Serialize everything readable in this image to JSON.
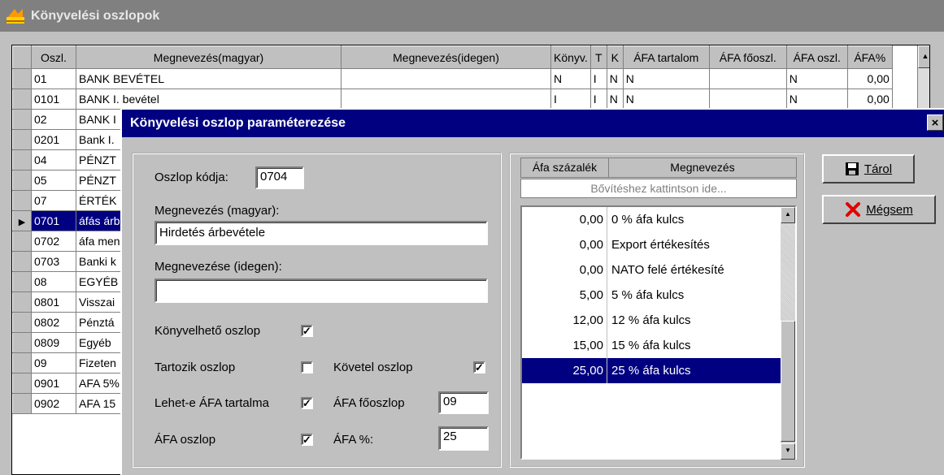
{
  "outer": {
    "title": "Könyvelési oszlopok",
    "columns": [
      "Oszl.",
      "Megnevezés(magyar)",
      "Megnevezés(idegen)",
      "Könyv.",
      "T",
      "K",
      "ÁFA tartalom",
      "ÁFA főoszl.",
      "ÁFA oszl.",
      "ÁFA%"
    ],
    "rows": [
      {
        "code": "01",
        "name": "BANK BEVÉTEL",
        "idegen": "",
        "konyv": "N",
        "t": "I",
        "k": "N",
        "afa_tart": "N",
        "afa_fo": "",
        "afa_oszl": "N",
        "afa_pct": "0,00",
        "selected": false
      },
      {
        "code": "0101",
        "name": "BANK I. bevétel",
        "idegen": "",
        "konyv": "I",
        "t": "I",
        "k": "N",
        "afa_tart": "N",
        "afa_fo": "",
        "afa_oszl": "N",
        "afa_pct": "0,00",
        "selected": false
      },
      {
        "code": "02",
        "name": "BANK I",
        "idegen": "",
        "konyv": "",
        "t": "",
        "k": "",
        "afa_tart": "",
        "afa_fo": "",
        "afa_oszl": "",
        "afa_pct": "",
        "selected": false
      },
      {
        "code": "0201",
        "name": "Bank I.",
        "idegen": "",
        "konyv": "",
        "t": "",
        "k": "",
        "afa_tart": "",
        "afa_fo": "",
        "afa_oszl": "",
        "afa_pct": "",
        "selected": false
      },
      {
        "code": "04",
        "name": "PÉNZT",
        "idegen": "",
        "konyv": "",
        "t": "",
        "k": "",
        "afa_tart": "",
        "afa_fo": "",
        "afa_oszl": "",
        "afa_pct": "",
        "selected": false
      },
      {
        "code": "05",
        "name": "PÉNZT",
        "idegen": "",
        "konyv": "",
        "t": "",
        "k": "",
        "afa_tart": "",
        "afa_fo": "",
        "afa_oszl": "",
        "afa_pct": "",
        "selected": false
      },
      {
        "code": "07",
        "name": "ÉRTÉK",
        "idegen": "",
        "konyv": "",
        "t": "",
        "k": "",
        "afa_tart": "",
        "afa_fo": "",
        "afa_oszl": "",
        "afa_pct": "",
        "selected": false
      },
      {
        "code": "0701",
        "name": "áfás árb",
        "idegen": "",
        "konyv": "",
        "t": "",
        "k": "",
        "afa_tart": "",
        "afa_fo": "",
        "afa_oszl": "",
        "afa_pct": "",
        "selected": true
      },
      {
        "code": "0702",
        "name": "áfa men",
        "idegen": "",
        "konyv": "",
        "t": "",
        "k": "",
        "afa_tart": "",
        "afa_fo": "",
        "afa_oszl": "",
        "afa_pct": "",
        "selected": false
      },
      {
        "code": "0703",
        "name": "Banki k",
        "idegen": "",
        "konyv": "",
        "t": "",
        "k": "",
        "afa_tart": "",
        "afa_fo": "",
        "afa_oszl": "",
        "afa_pct": "",
        "selected": false
      },
      {
        "code": "08",
        "name": "EGYÉB",
        "idegen": "",
        "konyv": "",
        "t": "",
        "k": "",
        "afa_tart": "",
        "afa_fo": "",
        "afa_oszl": "",
        "afa_pct": "",
        "selected": false
      },
      {
        "code": "0801",
        "name": "Visszai",
        "idegen": "",
        "konyv": "",
        "t": "",
        "k": "",
        "afa_tart": "",
        "afa_fo": "",
        "afa_oszl": "",
        "afa_pct": "",
        "selected": false
      },
      {
        "code": "0802",
        "name": "Pénztá",
        "idegen": "",
        "konyv": "",
        "t": "",
        "k": "",
        "afa_tart": "",
        "afa_fo": "",
        "afa_oszl": "",
        "afa_pct": "",
        "selected": false
      },
      {
        "code": "0809",
        "name": "Egyéb",
        "idegen": "",
        "konyv": "",
        "t": "",
        "k": "",
        "afa_tart": "",
        "afa_fo": "",
        "afa_oszl": "",
        "afa_pct": "",
        "selected": false
      },
      {
        "code": "09",
        "name": "Fizeten",
        "idegen": "",
        "konyv": "",
        "t": "",
        "k": "",
        "afa_tart": "",
        "afa_fo": "",
        "afa_oszl": "",
        "afa_pct": "",
        "selected": false
      },
      {
        "code": "0901",
        "name": "AFA 5%",
        "idegen": "",
        "konyv": "",
        "t": "",
        "k": "",
        "afa_tart": "",
        "afa_fo": "",
        "afa_oszl": "",
        "afa_pct": "",
        "selected": false
      },
      {
        "code": "0902",
        "name": "AFA 15",
        "idegen": "",
        "konyv": "",
        "t": "",
        "k": "",
        "afa_tart": "",
        "afa_fo": "",
        "afa_oszl": "",
        "afa_pct": "",
        "selected": false
      }
    ]
  },
  "dialog": {
    "title": "Könyvelési oszlop paraméterezése",
    "close_label": "×",
    "oszlop_kodja_label": "Oszlop kódja:",
    "oszlop_kodja_value": "0704",
    "megnevezes_magyar_label": "Megnevezés (magyar):",
    "megnevezes_magyar_value": "Hirdetés árbevétele",
    "megnevezes_idegen_label": "Megnevezése (idegen):",
    "megnevezes_idegen_value": "",
    "konyvelheto_label": "Könyvelhető oszlop",
    "konyvelheto_checked": true,
    "tartozik_label": "Tartozik oszlop",
    "tartozik_checked": false,
    "kovetel_label": "Követel oszlop",
    "kovetel_checked": true,
    "lehet_afa_label": "Lehet-e ÁFA tartalma",
    "lehet_afa_checked": true,
    "afa_fooszlop_label": "ÁFA főoszlop",
    "afa_fooszlop_value": "09",
    "afa_oszlop_label": "ÁFA oszlop",
    "afa_oszlop_checked": true,
    "afa_pct_label": "ÁFA %:",
    "afa_pct_value": "25",
    "afa_table": {
      "headers": [
        "Áfa százalék",
        "Megnevezés"
      ],
      "hint": "Bővítéshez kattintson ide...",
      "rows": [
        {
          "pct": "0,00",
          "name": "0 % áfa kulcs",
          "selected": false
        },
        {
          "pct": "0,00",
          "name": "Export értékesítés",
          "selected": false
        },
        {
          "pct": "0,00",
          "name": "NATO felé értékesíté",
          "selected": false
        },
        {
          "pct": "5,00",
          "name": "5 % áfa kulcs",
          "selected": false
        },
        {
          "pct": "12,00",
          "name": "12 % áfa kulcs",
          "selected": false
        },
        {
          "pct": "15,00",
          "name": "15 % áfa kulcs",
          "selected": false
        },
        {
          "pct": "25,00",
          "name": "25 % áfa kulcs",
          "selected": true
        }
      ]
    },
    "save_button": "Tárol",
    "cancel_button": "Mégsem"
  }
}
